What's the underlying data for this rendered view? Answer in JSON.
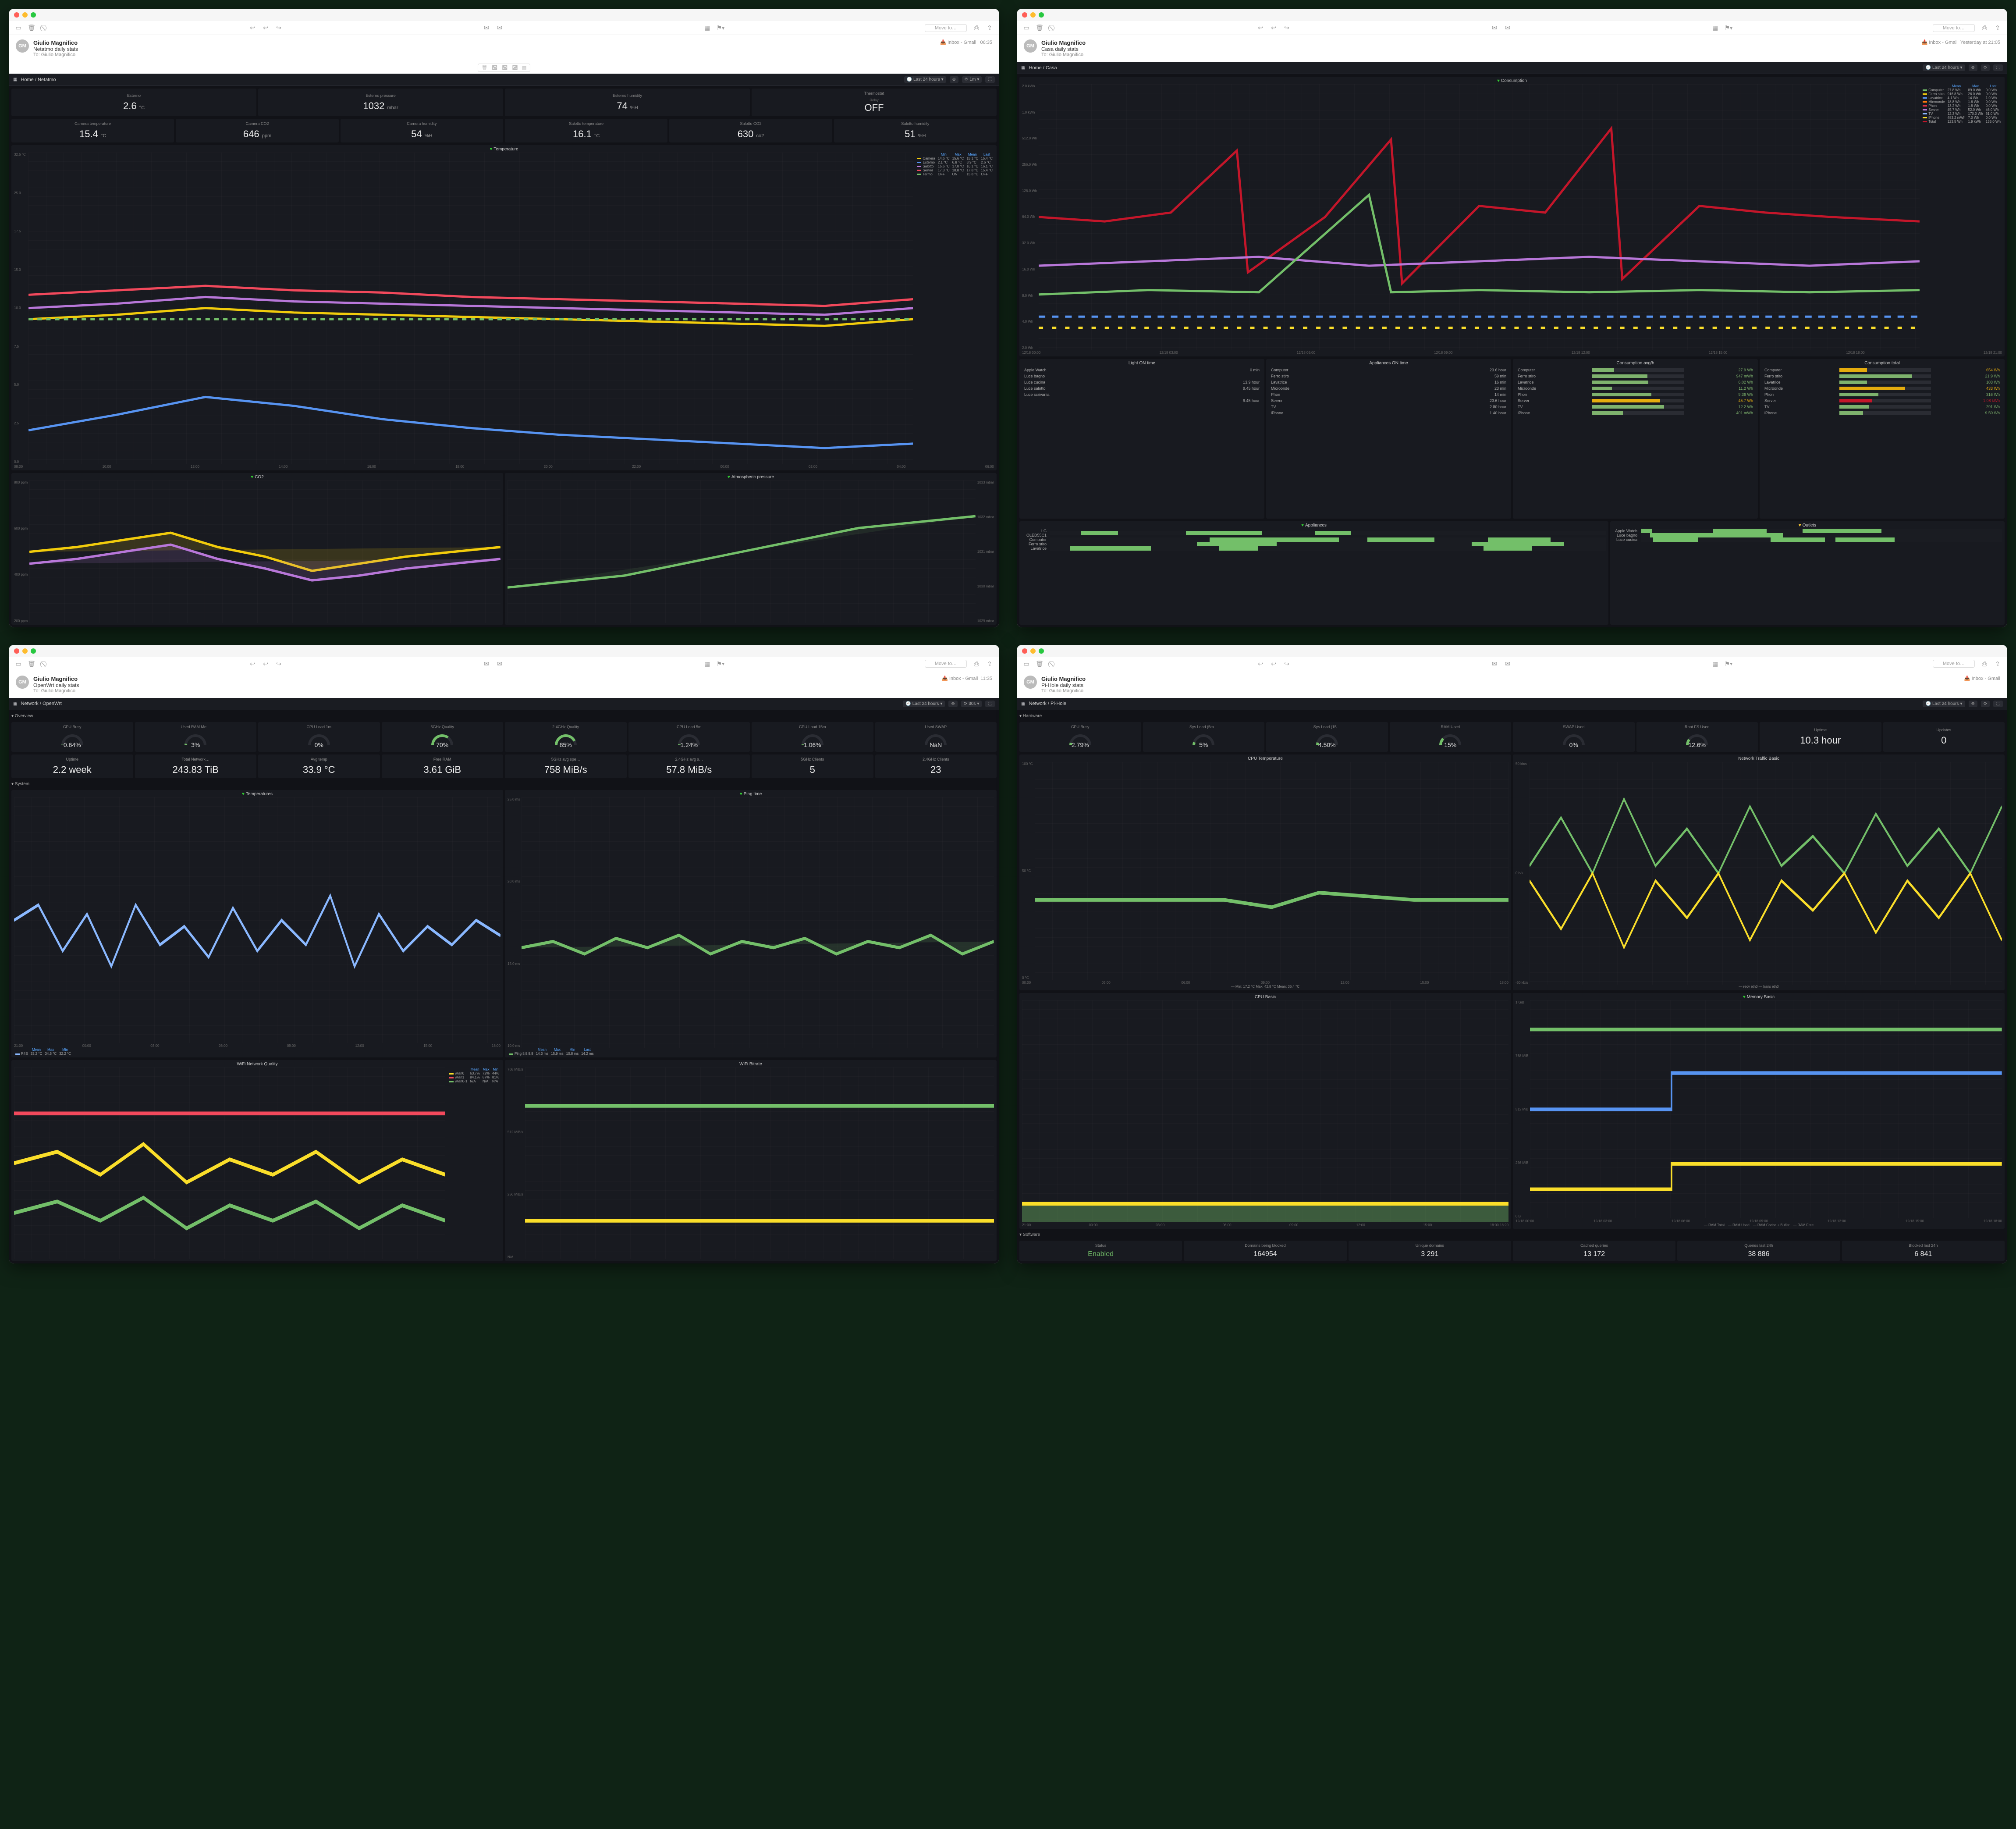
{
  "common": {
    "from": "Giulio Magnifico",
    "avatar": "GM",
    "to": "To:  Giulio Magnifico",
    "inbox": "Inbox - Gmail",
    "moveto": "Move to…",
    "range": "Last 24 hours"
  },
  "netatmo": {
    "subject": "Netatmo daily stats",
    "time": "06:35",
    "crumb": "Home / Netatmo",
    "refresh": "1m",
    "tiles1": [
      {
        "label": "Esterno",
        "val": "2.6",
        "unit": "°C"
      },
      {
        "label": "Esterno pressure",
        "val": "1032",
        "unit": "mbar"
      },
      {
        "label": "Esterno humidity",
        "val": "74",
        "unit": "%H"
      },
      {
        "label": "Thermostat",
        "pre": "Relay",
        "val": "OFF",
        "unit": ""
      }
    ],
    "tiles2": [
      {
        "label": "Camera temperature",
        "val": "15.4",
        "unit": "°C"
      },
      {
        "label": "Camera CO2",
        "val": "646",
        "unit": "ppm"
      },
      {
        "label": "Camera humidity",
        "val": "54",
        "unit": "%H"
      },
      {
        "label": "Salotto temperature",
        "val": "16.1",
        "unit": "°C"
      },
      {
        "label": "Salotto CO2",
        "val": "630",
        "unit": "co2"
      },
      {
        "label": "Salotto humidity",
        "val": "51",
        "unit": "%H"
      }
    ],
    "temp_legend_h": [
      "",
      "Min",
      "Max",
      "Mean",
      "Last"
    ],
    "temp_legend": [
      {
        "c": "#f2cc0c",
        "n": "Camera",
        "v": [
          "14.6 °C",
          "15.6 °C",
          "15.1 °C",
          "15.4 °C"
        ]
      },
      {
        "c": "#5794f2",
        "n": "Esterno",
        "v": [
          "2.1 °C",
          "6.8 °C",
          "3.9 °C",
          "2.6 °C"
        ]
      },
      {
        "c": "#b877d9",
        "n": "Salotto",
        "v": [
          "15.6 °C",
          "17.0 °C",
          "16.1 °C",
          "16.1 °C"
        ]
      },
      {
        "c": "#f2495c",
        "n": "Server",
        "v": [
          "17.3 °C",
          "18.8 °C",
          "17.8 °C",
          "15.4 °C"
        ]
      },
      {
        "c": "#73bf69",
        "n": "Termo",
        "v": [
          "OFF",
          "ON",
          "15.8 °C",
          "OFF"
        ]
      }
    ],
    "temp_x": [
      "08:00",
      "10:00",
      "12:00",
      "14:00",
      "16:00",
      "18:00",
      "20:00",
      "22:00",
      "00:00",
      "02:00",
      "04:00",
      "06:00"
    ],
    "temp_y": [
      "32.5 °C",
      "25.0",
      "17.5",
      "15.0",
      "10.0",
      "7.5",
      "5.0",
      "2.5",
      "0.0"
    ],
    "co2_y": [
      "800 ppm",
      "600 ppm",
      "400 ppm",
      "200 ppm"
    ],
    "press_y": [
      "1033 mbar",
      "1032 mbar",
      "1031 mbar",
      "1030 mbar",
      "1029 mbar"
    ],
    "chart_data": {
      "type": "line",
      "title": "Temperature",
      "series": [
        {
          "name": "Camera",
          "values": [
            15.0,
            15.2,
            15.6,
            15.4,
            15.3,
            15.2,
            15.1,
            15.0,
            14.8,
            14.7,
            14.6,
            15.4
          ]
        },
        {
          "name": "Esterno",
          "values": [
            3.5,
            5.8,
            6.8,
            6.0,
            4.5,
            3.8,
            3.2,
            3.0,
            2.6,
            2.4,
            2.2,
            2.6
          ]
        },
        {
          "name": "Salotto",
          "values": [
            16.0,
            16.5,
            17.0,
            16.8,
            16.5,
            16.3,
            16.1,
            16.0,
            15.8,
            15.7,
            15.6,
            16.1
          ]
        }
      ],
      "x": [
        "08:00",
        "10:00",
        "12:00",
        "14:00",
        "16:00",
        "18:00",
        "20:00",
        "22:00",
        "00:00",
        "02:00",
        "04:00",
        "06:00"
      ],
      "ylim": [
        0,
        32.5
      ]
    }
  },
  "casa": {
    "subject": "Casa daily stats",
    "time": "Yesterday at 21:05",
    "crumb": "Home / Casa",
    "refresh": "",
    "cons_y": [
      "2.0 kWh",
      "1.0 kWh",
      "512.0 Wh",
      "256.0 Wh",
      "128.0 Wh",
      "64.0 Wh",
      "32.0 Wh",
      "16.0 Wh",
      "8.0 Wh",
      "4.0 Wh",
      "2.0 Wh"
    ],
    "cons_x": [
      "12/18 00:00",
      "12/18 03:00",
      "12/18 06:00",
      "12/18 09:00",
      "12/18 12:00",
      "12/18 15:00",
      "12/18 18:00",
      "12/18 21:00"
    ],
    "cons_leg_h": [
      "",
      "Mean",
      "Max",
      "Last"
    ],
    "cons_leg": [
      {
        "c": "#73bf69",
        "n": "Computer",
        "v": [
          "27.8 Wh",
          "89.0 Wh",
          "0.0 Wh"
        ]
      },
      {
        "c": "#f2cc0c",
        "n": "Ferro stiro",
        "v": [
          "916.8 Wh",
          "26.0 Wh",
          "0.0 Wh"
        ]
      },
      {
        "c": "#5794f2",
        "n": "Lavatrice",
        "v": [
          "4.1 Wh",
          "14 Wh",
          "1.0 Wh"
        ]
      },
      {
        "c": "#ff780a",
        "n": "Microonde",
        "v": [
          "18.8 Wh",
          "1.6 Wh",
          "0.0 Wh"
        ]
      },
      {
        "c": "#e02f44",
        "n": "Phon",
        "v": [
          "13.2 Wh",
          "1.8 Wh",
          "0.0 Wh"
        ]
      },
      {
        "c": "#b877d9",
        "n": "Server",
        "v": [
          "45.7 Wh",
          "52.0 Wh",
          "46.0 Wh"
        ]
      },
      {
        "c": "#8ab8ff",
        "n": "TV",
        "v": [
          "12.3 Wh",
          "170.0 Wh",
          "61.0 Wh"
        ]
      },
      {
        "c": "#fade2a",
        "n": "iPhone",
        "v": [
          "483.2 mWh",
          "7.0 Wh",
          "0.0 Wh"
        ]
      },
      {
        "c": "#c4162a",
        "n": "Total",
        "v": [
          "123.5 Wh",
          "1.9 kWh",
          "133.0 Wh"
        ]
      }
    ],
    "light_on": [
      {
        "n": "Apple Watch",
        "v": "0 min"
      },
      {
        "n": "Luce bagno",
        "v": ""
      },
      {
        "n": "Luce cucina",
        "v": "13.9 hour"
      },
      {
        "n": "Luce salotto",
        "v": "9.45 hour"
      },
      {
        "n": "Luce scrivania",
        "v": ""
      },
      {
        "n": "",
        "v": "9.45 hour"
      }
    ],
    "appl_on": [
      {
        "n": "Computer",
        "v": "23.6 hour"
      },
      {
        "n": "Ferro stiro",
        "v": "59 min"
      },
      {
        "n": "Lavatrice",
        "v": "16 min"
      },
      {
        "n": "Microonde",
        "v": "23 min"
      },
      {
        "n": "Phon",
        "v": "14 min"
      },
      {
        "n": "Server",
        "v": "23.6 hour"
      },
      {
        "n": "TV",
        "v": "2.80 hour"
      },
      {
        "n": "iPhone",
        "v": "1.40 hour"
      }
    ],
    "cons_avg": [
      {
        "n": "Computer",
        "v": "27.9 Wh",
        "c": "#7eb26d"
      },
      {
        "n": "Ferro stiro",
        "v": "947 mWh",
        "c": "#7eb26d"
      },
      {
        "n": "Lavatrice",
        "v": "6.02 Wh",
        "c": "#7eb26d"
      },
      {
        "n": "Microonde",
        "v": "11.2 Wh",
        "c": "#7eb26d"
      },
      {
        "n": "Phon",
        "v": "9.36 Wh",
        "c": "#7eb26d"
      },
      {
        "n": "Server",
        "v": "45.7 Wh",
        "c": "#e5ac0e"
      },
      {
        "n": "TV",
        "v": "12.2 Wh",
        "c": "#7eb26d"
      },
      {
        "n": "iPhone",
        "v": "401 mWh",
        "c": "#7eb26d"
      }
    ],
    "cons_tot": [
      {
        "n": "Computer",
        "v": "654 Wh",
        "c": "#e5ac0e"
      },
      {
        "n": "Ferro stiro",
        "v": "21.9 Wh",
        "c": "#7eb26d"
      },
      {
        "n": "Lavatrice",
        "v": "103 Wh",
        "c": "#7eb26d"
      },
      {
        "n": "Microonde",
        "v": "433 Wh",
        "c": "#e5ac0e"
      },
      {
        "n": "Phon",
        "v": "316 Wh",
        "c": "#7eb26d"
      },
      {
        "n": "Server",
        "v": "1.08 kWh",
        "c": "#c4162a"
      },
      {
        "n": "TV",
        "v": "291 Wh",
        "c": "#7eb26d"
      },
      {
        "n": "iPhone",
        "v": "9.50 Wh",
        "c": "#7eb26d"
      }
    ],
    "appliances": [
      "LG OLED55C1",
      "Computer",
      "Ferro stiro",
      "Lavatrice"
    ],
    "outlets": [
      "Apple Watch",
      "Luce bagno",
      "Luce cucina"
    ]
  },
  "openwrt": {
    "subject": "OpenWrt daily stats",
    "time": "11:35",
    "crumb": "Network / OpenWrt",
    "refresh": "30s",
    "gauges": [
      {
        "l": "CPU Busy",
        "v": "0.64%",
        "p": 2,
        "c": "#73bf69"
      },
      {
        "l": "Used RAM Me…",
        "v": "3%",
        "p": 5,
        "c": "#73bf69"
      },
      {
        "l": "CPU Load 1m",
        "v": "0%",
        "p": 1,
        "c": "#73bf69"
      },
      {
        "l": "5GHz Quality",
        "v": "70%",
        "p": 70,
        "c": "#73bf69"
      },
      {
        "l": "2.4GHz Quality",
        "v": "85%",
        "p": 85,
        "c": "#73bf69"
      },
      {
        "l": "CPU Load 5m",
        "v": "1.24%",
        "p": 3,
        "c": "#73bf69"
      },
      {
        "l": "CPU Load 15m",
        "v": "1.06%",
        "p": 3,
        "c": "#73bf69"
      },
      {
        "l": "Used SWAP",
        "v": "NaN",
        "p": 0,
        "c": "#555"
      }
    ],
    "stats": [
      {
        "l": "Uptime",
        "v": "2.2 week"
      },
      {
        "l": "Total Network…",
        "v": "243.83 TiB"
      },
      {
        "l": "Avg temp",
        "v": "33.9 °C"
      },
      {
        "l": "Free RAM",
        "v": "3.61 GiB"
      },
      {
        "l": "5GHz avg spe…",
        "v": "758 MiB/s"
      },
      {
        "l": "2.4GHz avg s…",
        "v": "57.8 MiB/s"
      },
      {
        "l": "5GHz Clients",
        "v": "5"
      },
      {
        "l": "2.4GHz Clients",
        "v": "23"
      }
    ],
    "temps_x": [
      "21:00",
      "00:00",
      "03:00",
      "06:00",
      "09:00",
      "12:00",
      "15:00",
      "18:00"
    ],
    "temps_leg": [
      {
        "c": "#8ab8ff",
        "n": "R4S",
        "v": [
          "33.2 °C",
          "34.5 °C",
          "32.2 °C"
        ]
      }
    ],
    "ping_leg": [
      {
        "c": "#73bf69",
        "n": "Ping 8.8.8.8",
        "v": [
          "14.3 ms",
          "15.9 ms",
          "10.8 ms",
          "14.2 ms"
        ]
      }
    ],
    "ping_y": [
      "25.0 ms",
      "20.0 ms",
      "15.0 ms",
      "10.0 ms"
    ],
    "wifiq_leg": [
      {
        "c": "#fade2a",
        "n": "wlan0",
        "v": [
          "63.7%",
          "72%",
          "44%"
        ]
      },
      {
        "c": "#f2495c",
        "n": "wlan1",
        "v": [
          "84.1%",
          "87%",
          "81%"
        ]
      },
      {
        "c": "#73bf69",
        "n": "wlan0-1",
        "v": [
          "N/A",
          "N/A",
          "N/A"
        ]
      }
    ],
    "bitrate_y": [
      "768 MiB/s",
      "512 MiB/s",
      "256 MiB/s",
      "N/A"
    ]
  },
  "pihole": {
    "subject": "Pi-Hole daily stats",
    "time": "",
    "crumb": "Network / Pi-Hole",
    "refresh": "",
    "gauges": [
      {
        "l": "CPU Busy",
        "v": "2.79%",
        "p": 8,
        "c": "#73bf69"
      },
      {
        "l": "Sys Load (5m…",
        "v": "5%",
        "p": 10,
        "c": "#73bf69"
      },
      {
        "l": "Sys Load (15…",
        "v": "4.50%",
        "p": 9,
        "c": "#73bf69"
      },
      {
        "l": "RAM Used",
        "v": "15%",
        "p": 24,
        "c": "#73bf69"
      },
      {
        "l": "SWAP Used",
        "v": "0%",
        "p": 1,
        "c": "#73bf69"
      },
      {
        "l": "Root FS Used",
        "v": "12.6%",
        "p": 20,
        "c": "#73bf69"
      }
    ],
    "uptime": {
      "l": "Uptime",
      "v": "10.3 hour"
    },
    "updates": {
      "l": "Updates",
      "v": "0"
    },
    "cput_title": "CPU Temperature",
    "cput_foot": "— Min: 17.2 °C  Max: 42.8 °C  Mean: 36.4 °C",
    "net_title": "Network Traffic Basic",
    "net_foot": "— recv eth0  — trans eth0",
    "cpu_title": "CPU Basic",
    "cpu_x": [
      "21:00",
      "00:00",
      "03:00",
      "06:00",
      "09:00",
      "12:00",
      "15:00",
      "18:00 18:20"
    ],
    "mem_title": "Memory Basic",
    "mem_leg": [
      "RAM Total",
      "RAM Used",
      "RAM Cache + Buffer",
      "RAM Free"
    ],
    "mem_y": [
      "1 GiB",
      "768 MiB",
      "512 MiB",
      "256 MiB",
      "0 B"
    ],
    "mem_x": [
      "12/18 00:00",
      "12/18 03:00",
      "12/18 06:00",
      "12/18 09:00",
      "12/18 12:00",
      "12/18 15:00",
      "12/18 18:00"
    ],
    "soft": [
      {
        "l": "Status",
        "v": "Enabled"
      },
      {
        "l": "Domains being blocked",
        "v": "164954"
      },
      {
        "l": "Unique domains",
        "v": "3 291"
      },
      {
        "l": "Cached queries",
        "v": "13 172"
      },
      {
        "l": "Queries last 24h",
        "v": "38 886"
      },
      {
        "l": "Blocked last 24h",
        "v": "6 841"
      }
    ],
    "cput_x": [
      "00:00",
      "03:00",
      "06:00",
      "09:00",
      "12:00",
      "15:00",
      "18:00"
    ],
    "cput_y": [
      "100 °C",
      "50 °C",
      "0 °C"
    ],
    "net_y": [
      "50 kb/s",
      "0 b/s",
      "-50 kb/s"
    ]
  }
}
